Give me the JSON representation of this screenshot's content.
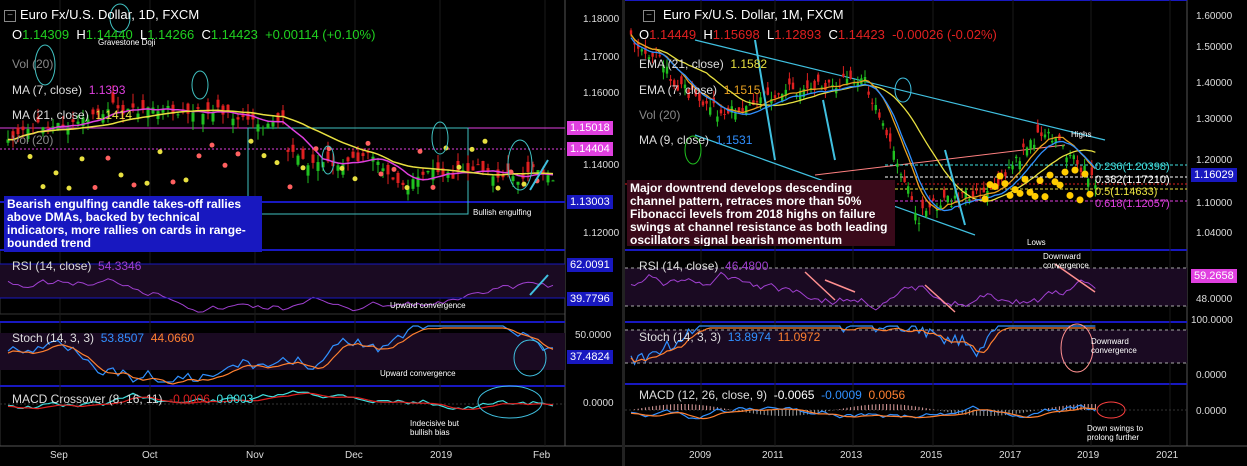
{
  "left": {
    "title": "Euro Fx/U.S. Dollar, 1D, FXCM",
    "ohlc": {
      "o_label": "O",
      "o": "1.14309",
      "h_label": "H",
      "h": "1.14440",
      "l_label": "L",
      "l": "1.14266",
      "c_label": "C",
      "c": "1.14423",
      "chg": "+0.00114 (+0.10%)"
    },
    "indicators": [
      {
        "name": "Vol (20)",
        "value": ""
      },
      {
        "name": "MA (7, close)",
        "value": "1.1393",
        "color": "#e040e0"
      },
      {
        "name": "MA (21, close)",
        "value": "1.1414",
        "color": "#e8e040"
      },
      {
        "name": "Vol (20)",
        "value": ""
      }
    ],
    "price_axis": [
      "1.18000",
      "1.17000",
      "1.16000",
      "1.15000",
      "1.14000",
      "1.13000",
      "1.12000"
    ],
    "price_boxes": [
      {
        "text": "1.15018",
        "bg": "#e040e0",
        "color": "#fff"
      },
      {
        "text": "1.14404",
        "bg": "#e040e0",
        "color": "#fff"
      },
      {
        "text": "1.13003",
        "bg": "#1818c0",
        "color": "#fff"
      }
    ],
    "annotation": "Bearish engulfing candle takes-off rallies above DMAs, backed by technical indicators, more rallies on cards in range-bounded trend",
    "notes": {
      "gravestone": "Gravestone Doji",
      "bullish_engulfing": "Bullish engulfing",
      "upward_conv_rsi": "Upward convergence",
      "upward_conv_stoch": "Upward convergence",
      "indecisive": "Indecisive but bullish bias"
    },
    "rsi": {
      "label": "RSI (14, close)",
      "value": "54.3346",
      "box1": "62.0091",
      "box2": "39.7796"
    },
    "stoch": {
      "label": "Stoch (14, 3, 3)",
      "k": "53.8507",
      "d": "44.0660",
      "axis_top": "50.0000",
      "box": "37.4824"
    },
    "macd": {
      "label": "MACD Crossover (8, 16, 11)",
      "v1": "-0.0006",
      "v2": "0.0003",
      "axis": "0.0000"
    },
    "time_axis": [
      "Sep",
      "Oct",
      "Nov",
      "Dec",
      "2019",
      "Feb"
    ]
  },
  "right": {
    "title": "Euro Fx/U.S. Dollar, 1M, FXCM",
    "ohlc": {
      "o_label": "O",
      "o": "1.14449",
      "h_label": "H",
      "h": "1.15698",
      "l_label": "L",
      "l": "1.12893",
      "c_label": "C",
      "c": "1.14423",
      "chg": "-0.00026 (-0.02%)"
    },
    "indicators": [
      {
        "name": "EMA (21, close)",
        "value": "1.1582",
        "color": "#e8e040"
      },
      {
        "name": "EMA (7, close)",
        "value": "1.1515",
        "color": "#e8a020"
      },
      {
        "name": "Vol (20)",
        "value": ""
      },
      {
        "name": "MA (9, close)",
        "value": "1.1531",
        "color": "#3090ff"
      }
    ],
    "price_axis": [
      "1.60000",
      "1.50000",
      "1.40000",
      "1.30000",
      "1.20000",
      "1.10000",
      "1.04000"
    ],
    "price_box": {
      "text": "1.16029",
      "bg": "#1818c0",
      "color": "#fff"
    },
    "fib": [
      {
        "text": "0.236(1.20398)",
        "color": "#40e0e0"
      },
      {
        "text": "0.382(1.17210)",
        "color": "#ffffff"
      },
      {
        "text": "0.5(1.14633)",
        "color": "#e8e040"
      },
      {
        "text": "0.618(1.12057)",
        "color": "#e040e0"
      }
    ],
    "annotation": "Major downtrend develops descending channel pattern, retraces more than 50% Fibonacci levels from 2018 highs on failure swings at channel resistance as both leading oscillators signal bearish momentum",
    "notes": {
      "highs": "Highs",
      "lows": "Lows",
      "down_conv_rsi": "Downward convergence",
      "down_conv_stoch": "Downward convergence",
      "down_swings": "Down swings to prolong further"
    },
    "rsi": {
      "label": "RSI (14, close)",
      "value": "46.4800",
      "box": "59.2658",
      "axis": "48.0000"
    },
    "stoch": {
      "label": "Stoch (14, 3, 3)",
      "k": "13.8974",
      "d": "11.0972",
      "axis_top": "100.0000",
      "axis_bot": "0.0000"
    },
    "macd": {
      "label": "MACD (12, 26, close, 9)",
      "v1": "-0.0065",
      "v2": "-0.0009",
      "v3": "0.0056",
      "axis": "0.0000"
    },
    "time_axis": [
      "2009",
      "2011",
      "2013",
      "2015",
      "2017",
      "2019",
      "2021"
    ]
  },
  "colors": {
    "bull": "#20c020",
    "bear": "#e02020",
    "ma_magenta": "#e040e0",
    "ma_yellow": "#e8e040",
    "cyan": "#40e0e0",
    "blue": "#1818c0"
  }
}
